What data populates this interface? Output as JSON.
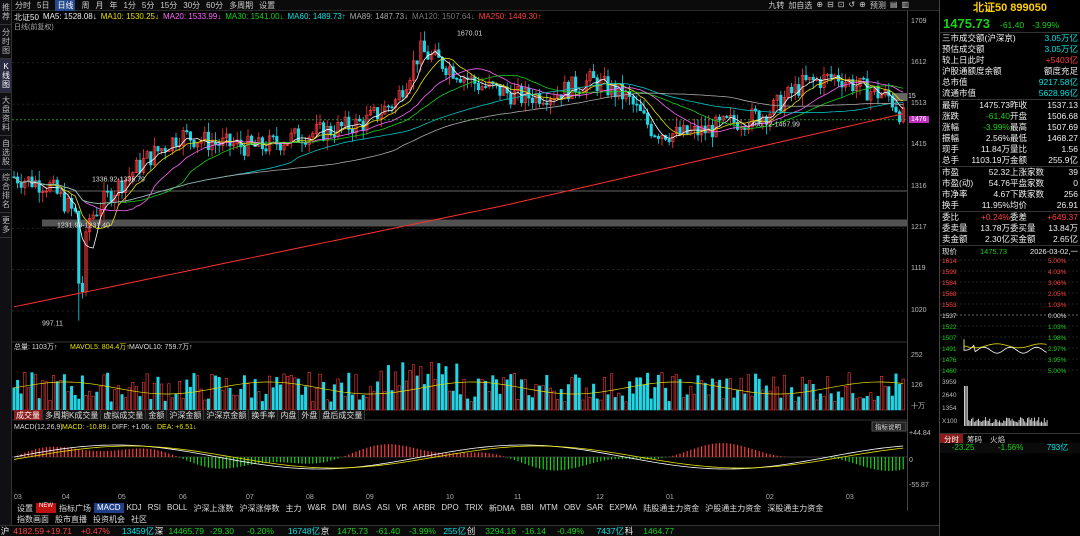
{
  "left_tabs": [
    "推荐",
    "分时图",
    "K线图",
    "大盘资料",
    "自选股",
    "综合排名",
    "更多"
  ],
  "toolbar": {
    "items": [
      "分时",
      "5日",
      "日线",
      "周",
      "月",
      "年",
      "1分",
      "5分",
      "15分",
      "30分",
      "60分",
      "多周期",
      "设置"
    ],
    "active": "日线",
    "right": [
      "九转",
      "加自选",
      "⊕",
      "⊟",
      "⊡",
      "↺",
      "⊕",
      "预测",
      "▤",
      "▥"
    ]
  },
  "legend": {
    "name": "北证50",
    "ma5": "MA5: 1528.08↓",
    "ma10": "MA10: 1530.25↓",
    "ma20": "MA20: 1533.99↓",
    "ma30": "MA30: 1541.00↓",
    "ma60": "MA60: 1489.73↑",
    "ma89": "MA89: 1487.73↓",
    "ma120": "MA120: 1507.64↓",
    "ma250": "MA250: 1449.30↑",
    "period": "日线(前复权)"
  },
  "chart_data": {
    "type": "candlestick",
    "title": "北证50 899050 日线",
    "y_ticks": [
      "1709",
      "1612",
      "1513",
      "1415",
      "1316",
      "1217",
      "1119",
      "1020"
    ],
    "y_values": [
      1709,
      1612,
      1513,
      1415,
      1316,
      1217,
      1119,
      1020
    ],
    "annotations": [
      "1670.01",
      "1336.92-1336.79",
      "1231.99-1231.40",
      "997.11",
      "1465.72-1467.99"
    ],
    "current_price_tag": "1476",
    "last_tag": "15",
    "x_months": [
      "03",
      "04",
      "05",
      "06",
      "07",
      "08",
      "09",
      "10",
      "11",
      "12",
      "01",
      "02",
      "03"
    ],
    "volume": {
      "label": "总量: 1103万↑",
      "mavol5": "MAVOL5: 804.4万↑",
      "mavol10": "MAVOL10: 759.7万↑",
      "ticks": [
        "252",
        "126",
        "十万"
      ]
    },
    "macd": {
      "label": "MACD(12,26,9)",
      "macd": "MACD: -10.89↓",
      "diff": "DIFF: +1.06↓",
      "dea": "DEA: +6.51↓",
      "ticks": [
        "+44.84",
        "0",
        "-55.87"
      ],
      "btn": "指标说明"
    }
  },
  "sub_tabs": [
    "成交量",
    "多周期K成交量",
    "虚拟成交量",
    "金额",
    "沪深金额",
    "沪深京金额",
    "换手率",
    "内盘",
    "外盘",
    "盘后成交量"
  ],
  "ind_tabs": [
    "设置",
    "NEW",
    "指标广场",
    "MACD",
    "KDJ",
    "RSI",
    "BOLL",
    "沪深上涨数",
    "沪深涨停数",
    "主力",
    "W&R",
    "DMI",
    "BIAS",
    "ASI",
    "VR",
    "ARBR",
    "DPO",
    "TRIX",
    "新DMA",
    "BBI",
    "MTM",
    "OBV",
    "SAR",
    "EXPMA",
    "陆股通主力资金",
    "沪股通主力资金",
    "深股通主力资金"
  ],
  "nav_tabs": [
    "指数画面",
    "股市直播",
    "投资机会",
    "社区"
  ],
  "bottom": [
    {
      "t": "沪",
      "c": "white"
    },
    {
      "t": "4182.59",
      "c": "red"
    },
    {
      "t": "+19.71",
      "c": "red"
    },
    {
      "t": "+0.47%",
      "c": "red"
    },
    {
      "t": "13459亿",
      "c": "cyan"
    },
    {
      "t": "深",
      "c": "white"
    },
    {
      "t": "14465.79",
      "c": "green"
    },
    {
      "t": "-29.30",
      "c": "green"
    },
    {
      "t": "-0.20%",
      "c": "green"
    },
    {
      "t": "16748亿",
      "c": "cyan"
    },
    {
      "t": "京",
      "c": "white"
    },
    {
      "t": "1475.73",
      "c": "green"
    },
    {
      "t": "-61.40",
      "c": "green"
    },
    {
      "t": "-3.99%",
      "c": "green"
    },
    {
      "t": "255亿",
      "c": "cyan"
    },
    {
      "t": "创",
      "c": "white"
    },
    {
      "t": "3294.16",
      "c": "green"
    },
    {
      "t": "-16.14",
      "c": "green"
    },
    {
      "t": "-0.49%",
      "c": "green"
    },
    {
      "t": "7437亿",
      "c": "cyan"
    },
    {
      "t": "科",
      "c": "white"
    },
    {
      "t": "1464.77",
      "c": "green"
    }
  ],
  "quote": {
    "title": "北证50 899050",
    "price": "1475.73",
    "chg": "-61.40",
    "pct": "-3.99%",
    "rows1": [
      [
        "三市成交额(沪深京)",
        "3.05万亿"
      ],
      [
        "预估成交额",
        "3.05万亿"
      ],
      [
        "较上日此时",
        "+5403亿"
      ],
      [
        "沪股通额度余额",
        "额度充足"
      ],
      [
        "总市值",
        "9217.58亿"
      ],
      [
        "流通市值",
        "5628.96亿"
      ]
    ],
    "rows2": [
      [
        "最新",
        "1475.73",
        "昨收",
        "1537.13"
      ],
      [
        "涨跌",
        "-61.40",
        "开盘",
        "1506.68"
      ],
      [
        "涨幅",
        "-3.99%",
        "最高",
        "1507.69"
      ],
      [
        "振幅",
        "2.56%",
        "最低",
        "1468.27"
      ],
      [
        "现手",
        "11.84万",
        "量比",
        "1.56"
      ],
      [
        "总手",
        "1103.19万",
        "金额",
        "255.9亿"
      ]
    ],
    "rows3": [
      [
        "市盈",
        "52.32",
        "上涨家数",
        "39"
      ],
      [
        "市盈(动)",
        "54.76",
        "平盘家数",
        "0"
      ],
      [
        "市净率",
        "4.67",
        "下跌家数",
        "256"
      ],
      [
        "换手",
        "11.95%",
        "均价",
        "26.91"
      ]
    ],
    "rows4": [
      [
        "委比",
        "+0.24%",
        "委差",
        "+649.37"
      ],
      [
        "委卖量",
        "13.78万",
        "委买量",
        "13.84万"
      ],
      [
        "卖金额",
        "2.30亿",
        "买金额",
        "2.65亿"
      ]
    ],
    "intraday": {
      "label": "现价",
      "price": "1475.73",
      "date": "2026-03-02,一",
      "lprices": [
        "1614",
        "1599",
        "1584",
        "1568",
        "1553",
        "1537",
        "1522",
        "1507",
        "1491",
        "1476",
        "1460"
      ],
      "rpcts": [
        "5.00%",
        "4.03%",
        "3.06%",
        "2.05%",
        "1.03%",
        "0.00%",
        "1.03%",
        "1.98%",
        "2.97%",
        "3.95%",
        "5.00%"
      ],
      "vol": [
        "3959",
        "2640",
        "1354",
        "X100"
      ]
    },
    "tabs": [
      "分时",
      "筹码",
      "火焰"
    ],
    "foot": [
      "-23.25",
      "-1.56%",
      "793亿"
    ]
  },
  "colors": {
    "up": "#ff3b3b",
    "down": "#1fd6e6",
    "bg": "#000000"
  }
}
